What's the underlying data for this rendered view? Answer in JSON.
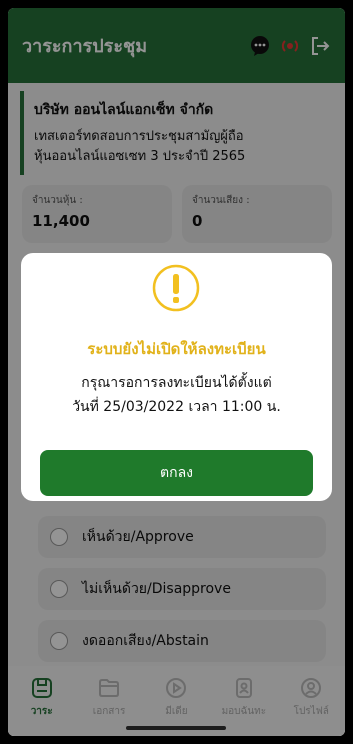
{
  "header": {
    "title": "วาระการประชุม",
    "icons": [
      "chat-icon",
      "broadcast-icon",
      "logout-icon"
    ]
  },
  "company": {
    "name": "บริษัท ออนไลน์แอกเซ็ท จำกัด",
    "desc_line1": "เทสเตอร์ทดสอบการประชุมสามัญผู้ถือ",
    "desc_line2": "หุ้นออนไลน์แอซเซท 3 ประจำปี 2565"
  },
  "stats": [
    {
      "label": "จำนวนหุ้น :",
      "value": "11,400"
    },
    {
      "label": "จำนวนเสียง :",
      "value": "0"
    }
  ],
  "vote_options": [
    {
      "label": "เห็นด้วย/Approve"
    },
    {
      "label": "ไม่เห็นด้วย/Disapprove"
    },
    {
      "label": "งดออกเสียง/Abstain"
    }
  ],
  "modal": {
    "title": "ระบบยังไม่เปิดให้ลงทะเบียน",
    "msg_line1": "กรุณารอการลงทะเบียนได้ตั้งแต่",
    "msg_line2": "วันที่ 25/03/2022 เวลา 11:00 น.",
    "ok_label": "ตกลง"
  },
  "tabs": [
    {
      "label": "วาระ",
      "icon": "agenda-icon",
      "active": true
    },
    {
      "label": "เอกสาร",
      "icon": "document-icon",
      "active": false
    },
    {
      "label": "มีเดีย",
      "icon": "media-icon",
      "active": false
    },
    {
      "label": "มอบฉันทะ",
      "icon": "proxy-icon",
      "active": false
    },
    {
      "label": "โปรไฟล์",
      "icon": "profile-icon",
      "active": false
    }
  ],
  "colors": {
    "primary": "#27703a",
    "button": "#1f7a2b",
    "warning": "#f2c020",
    "title_warning": "#e1b21a"
  }
}
